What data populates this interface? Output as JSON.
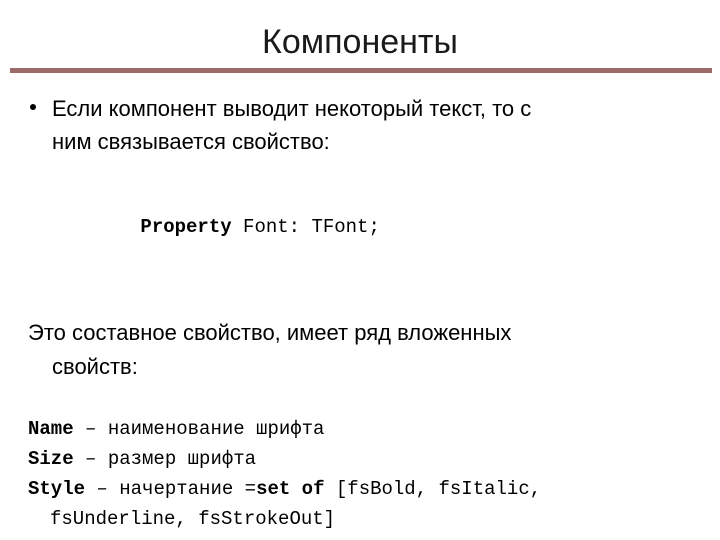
{
  "slide": {
    "title": "Компоненты",
    "rule_color": "#9c6a68",
    "background": "#ffffff",
    "text_color": "#000000"
  },
  "bullet": {
    "marker": "bullet-dot",
    "line1": "Если компонент выводит некоторый текст, то с",
    "line2": "ним связывается свойство:"
  },
  "declaration": {
    "keyword": "Property",
    "rest": " Font: TFont;"
  },
  "paragraph": {
    "line1": "Это составное свойство, имеет ряд вложенных",
    "line2": "свойств:"
  },
  "properties": [
    {
      "name": "Name",
      "separator": " – ",
      "description": "наименование шрифта",
      "bold_mid": "",
      "tail": "",
      "continuation": ""
    },
    {
      "name": "Size",
      "separator": " – ",
      "description": "размер шрифта",
      "bold_mid": "",
      "tail": "",
      "continuation": ""
    },
    {
      "name": "Style",
      "separator": " – ",
      "description": "начертание =",
      "bold_mid": "set of",
      "tail": " [fsBold, fsItalic,",
      "continuation": "fsUnderline, fsStrokeOut]"
    }
  ]
}
